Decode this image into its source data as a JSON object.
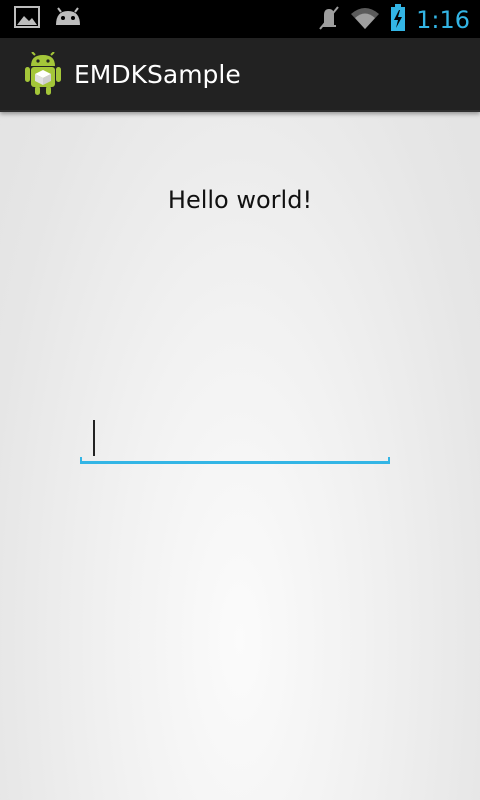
{
  "status_bar": {
    "time": "1:16",
    "left_icons": [
      "picture-icon",
      "android-debug-icon"
    ],
    "right_icons": [
      "mute-icon",
      "wifi-icon",
      "battery-charging-icon"
    ],
    "accent_color": "#33b5e5"
  },
  "action_bar": {
    "title": "EMDKSample",
    "app_icon": "android-robot-icon"
  },
  "main": {
    "greeting": "Hello world!",
    "input": {
      "value": "",
      "placeholder": ""
    }
  }
}
